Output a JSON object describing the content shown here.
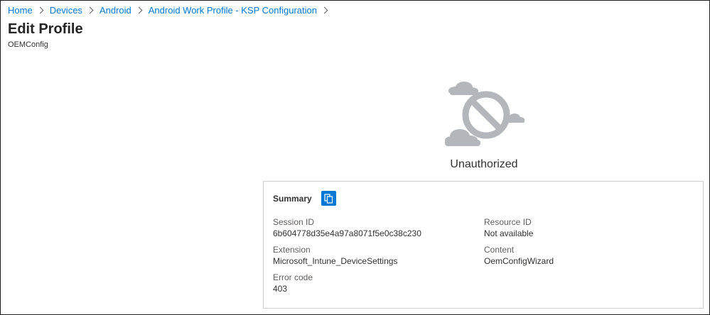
{
  "breadcrumb": [
    "Home",
    "Devices",
    "Android",
    "Android Work Profile - KSP Configuration"
  ],
  "page": {
    "title": "Edit Profile",
    "subtitle": "OEMConfig"
  },
  "status": {
    "title": "Unauthorized",
    "icon": "blocked-cloud-icon"
  },
  "summary": {
    "label": "Summary",
    "copy_icon": "copy-icon",
    "fields": {
      "session_id": {
        "label": "Session ID",
        "value": "6b604778d35e4a97a8071f5e0c38c230"
      },
      "resource_id": {
        "label": "Resource ID",
        "value": "Not available"
      },
      "extension": {
        "label": "Extension",
        "value": "Microsoft_Intune_DeviceSettings"
      },
      "content": {
        "label": "Content",
        "value": "OemConfigWizard"
      },
      "error_code": {
        "label": "Error code",
        "value": "403"
      }
    }
  },
  "colors": {
    "link": "#0078d4",
    "accent_button": "#0078d4",
    "illustration_gray": "#b3b7bb",
    "card_border": "#d2d0ce"
  }
}
